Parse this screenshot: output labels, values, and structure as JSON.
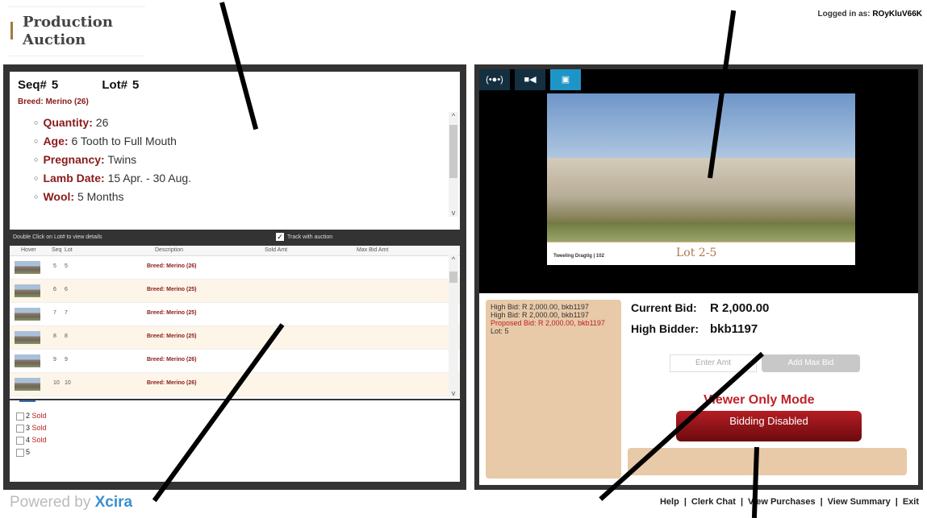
{
  "logo": {
    "text": "Production\nAuction"
  },
  "login": {
    "label": "Logged in as:",
    "user": "ROyKluV66K"
  },
  "lot_detail": {
    "seq_label": "Seq#",
    "seq": "5",
    "lot_label": "Lot#",
    "lot": "5",
    "breed": "Breed: Merino (26)",
    "items": [
      {
        "label": "Quantity:",
        "value": "26"
      },
      {
        "label": "Age:",
        "value": "6 Tooth to Full Mouth"
      },
      {
        "label": "Pregnancy:",
        "value": "Twins"
      },
      {
        "label": "Lamb Date:",
        "value": "15 Apr. - 30 Aug."
      },
      {
        "label": "Wool:",
        "value": "5 Months"
      }
    ]
  },
  "list": {
    "hint": "Double Click on Lot# to view details",
    "track_label": "Track with auction",
    "columns": [
      "Hover",
      "Seq",
      "Lot",
      "Description",
      "Sold Amt",
      "Max Bid Amt"
    ],
    "rows": [
      {
        "seq": "5",
        "lot": "5",
        "desc": "Breed: Merino (26)"
      },
      {
        "seq": "6",
        "lot": "6",
        "desc": "Breed: Merino (25)"
      },
      {
        "seq": "7",
        "lot": "7",
        "desc": "Breed: Merino (25)"
      },
      {
        "seq": "8",
        "lot": "8",
        "desc": "Breed: Merino (25)"
      },
      {
        "seq": "9",
        "lot": "9",
        "desc": "Breed: Merino (26)"
      },
      {
        "seq": "10",
        "lot": "10",
        "desc": "Breed: Merino (26)"
      }
    ]
  },
  "sold_items": [
    {
      "num": "2",
      "status": "Sold"
    },
    {
      "num": "3",
      "status": "Sold"
    },
    {
      "num": "4",
      "status": "Sold"
    },
    {
      "num": "5",
      "status": ""
    }
  ],
  "video": {
    "buttons": [
      "audio-icon",
      "video-icon",
      "image-icon"
    ],
    "caption": "Tweeling Dragtig | 102",
    "lot_title": "Lot 2-5"
  },
  "history": {
    "lines": [
      "High Bid: R 2,000.00, bkb1197",
      "High Bid: R 2,000.00, bkb1197"
    ],
    "proposed": "Proposed Bid: R 2,000.00, bkb1197",
    "lot": "Lot: 5"
  },
  "bid": {
    "current_label": "Current Bid:",
    "current_value": "R 2,000.00",
    "bidder_label": "High Bidder:",
    "bidder_value": "bkb1197",
    "input_placeholder": "Enter Amt",
    "add_max_bid": "Add Max Bid",
    "viewer_mode": "Viewer Only Mode",
    "disabled": "Bidding Disabled"
  },
  "powered": {
    "prefix": "Powered by",
    "brand": "Xcira"
  },
  "footer": {
    "help": "Help",
    "clerk_chat": "Clerk Chat",
    "view_purchases": "View Purchases",
    "view_summary": "View Summary",
    "exit": "Exit",
    "sep": "|"
  },
  "colors": {
    "accent_red": "#8b1a1a",
    "bid_button": "#9b1218",
    "panel_beige": "#e8c9a8",
    "video_button": "#1f95c7"
  }
}
